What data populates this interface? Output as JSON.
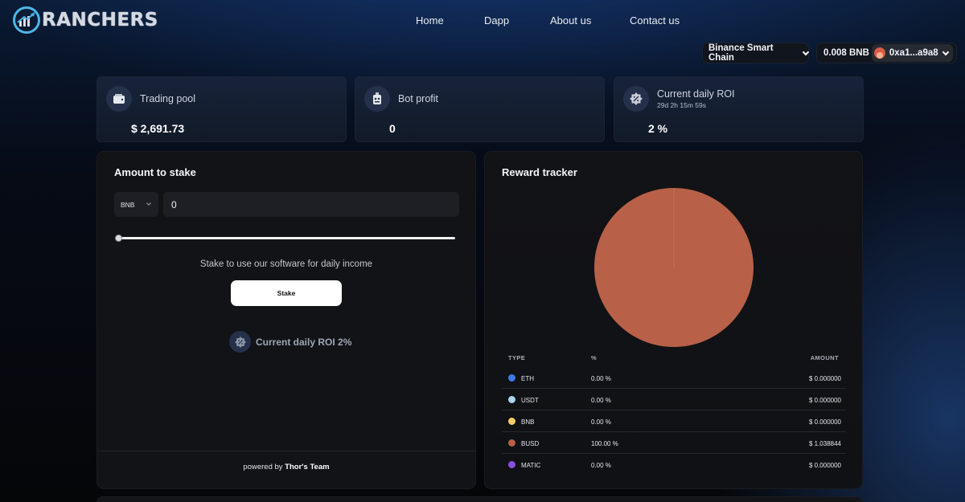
{
  "brand": {
    "logo_text": "RANCHERS",
    "accent": "#4db6e8"
  },
  "nav": [
    {
      "label": "Home"
    },
    {
      "label": "Dapp"
    },
    {
      "label": "About us"
    },
    {
      "label": "Contact us"
    }
  ],
  "wallet": {
    "network": "Binance Smart Chain",
    "balance": "0.008 BNB",
    "address": "0xa1...a9a8"
  },
  "stats": {
    "trading_pool": {
      "label": "Trading pool",
      "value": "$ 2,691.73",
      "icon": "wallet-icon"
    },
    "bot_profit": {
      "label": "Bot profit",
      "value": "0",
      "icon": "robot-icon"
    },
    "daily_roi": {
      "label": "Current daily ROI",
      "sub": "29d 2h 15m 59s",
      "value": "2 %",
      "icon": "percent-badge-icon"
    }
  },
  "stake": {
    "title": "Amount to stake",
    "currency": "BNB",
    "amount": "0",
    "slider_value_pct": 0,
    "hint": "Stake to use our software for daily income",
    "button": "Stake",
    "roi_text": "Current daily ROI 2%",
    "powered_prefix": "powered by",
    "powered_by": "Thor's Team"
  },
  "reward": {
    "title": "Reward tracker",
    "columns": {
      "type": "TYPE",
      "pct": "%",
      "amount": "AMOUNT"
    },
    "rows": [
      {
        "type": "ETH",
        "pct": "0.00 %",
        "amount": "$ 0.000000",
        "color": "#3b7be8"
      },
      {
        "type": "USDT",
        "pct": "0.00 %",
        "amount": "$ 0.000000",
        "color": "#a9d4f2"
      },
      {
        "type": "BNB",
        "pct": "0.00 %",
        "amount": "$ 0.000000",
        "color": "#f4cd64"
      },
      {
        "type": "BUSD",
        "pct": "100.00 %",
        "amount": "$ 1.038844",
        "color": "#b86148"
      },
      {
        "type": "MATIC",
        "pct": "0.00 %",
        "amount": "$ 0.000000",
        "color": "#8a4fe0"
      }
    ]
  },
  "chart_data": {
    "type": "pie",
    "categories": [
      "ETH",
      "USDT",
      "BNB",
      "BUSD",
      "MATIC"
    ],
    "values": [
      0.0,
      0.0,
      0.0,
      100.0,
      0.0
    ],
    "colors": [
      "#3b7be8",
      "#a9d4f2",
      "#f4cd64",
      "#b86148",
      "#8a4fe0"
    ]
  }
}
